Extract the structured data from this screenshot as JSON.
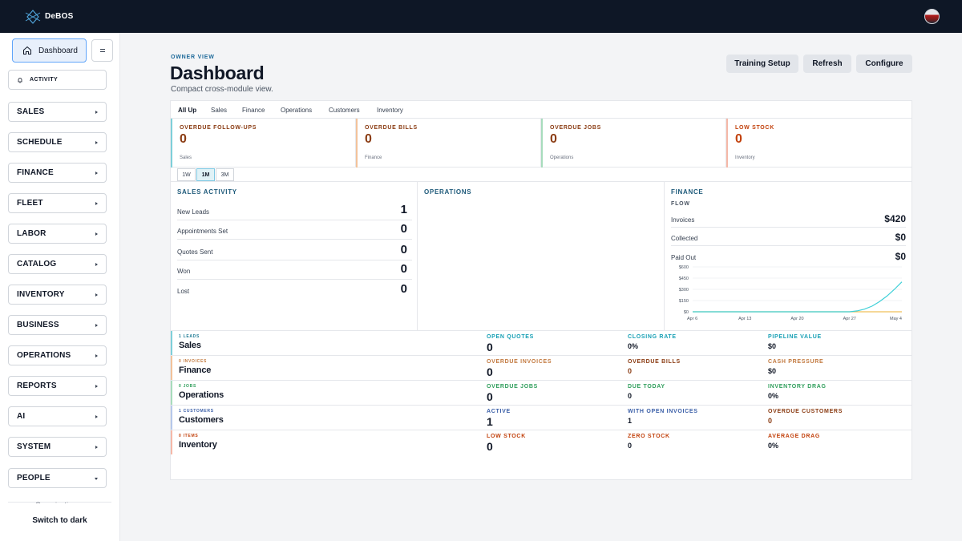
{
  "app": {
    "brand": "DeBOS"
  },
  "sidebar": {
    "dashboard_label": "Dashboard",
    "activity_label": "ACTIVITY",
    "items": [
      {
        "label": "SALES"
      },
      {
        "label": "SCHEDULE"
      },
      {
        "label": "FINANCE"
      },
      {
        "label": "FLEET"
      },
      {
        "label": "LABOR"
      },
      {
        "label": "CATALOG"
      },
      {
        "label": "INVENTORY"
      },
      {
        "label": "BUSINESS"
      },
      {
        "label": "OPERATIONS"
      },
      {
        "label": "REPORTS"
      },
      {
        "label": "AI"
      },
      {
        "label": "SYSTEM"
      },
      {
        "label": "PEOPLE"
      }
    ],
    "footer_peek": "Organization",
    "switch_theme_label": "Switch to dark"
  },
  "header": {
    "eyebrow": "OWNER VIEW",
    "title": "Dashboard",
    "subtitle": "Compact cross-module view.",
    "buttons": {
      "training": "Training Setup",
      "refresh": "Refresh",
      "configure": "Configure"
    }
  },
  "tabs": [
    "All Up",
    "Sales",
    "Finance",
    "Operations",
    "Customers",
    "Inventory"
  ],
  "kpis": [
    {
      "label": "OVERDUE FOLLOW-UPS",
      "value": "0",
      "module": "Sales",
      "color": "#8a3b12",
      "bar": "#7ecfd9"
    },
    {
      "label": "OVERDUE BILLS",
      "value": "0",
      "module": "Finance",
      "color": "#8a3b12",
      "bar": "#f2c29a"
    },
    {
      "label": "OVERDUE JOBS",
      "value": "0",
      "module": "Operations",
      "color": "#8a3b12",
      "bar": "#a7dcbc"
    },
    {
      "label": "LOW STOCK",
      "value": "0",
      "module": "Inventory",
      "color": "#c2410c",
      "bar": "#f5b8a8"
    }
  ],
  "ranges": [
    "1W",
    "1M",
    "3M"
  ],
  "sales_activity": {
    "title": "SALES ACTIVITY",
    "rows": [
      {
        "label": "New Leads",
        "value": "1"
      },
      {
        "label": "Appointments Set",
        "value": "0"
      },
      {
        "label": "Quotes Sent",
        "value": "0"
      },
      {
        "label": "Won",
        "value": "0"
      },
      {
        "label": "Lost",
        "value": "0"
      }
    ]
  },
  "operations": {
    "title": "OPERATIONS"
  },
  "finance": {
    "title": "FINANCE",
    "flow_label": "FLOW",
    "rows": [
      {
        "label": "Invoices",
        "value": "$420"
      },
      {
        "label": "Collected",
        "value": "$0"
      },
      {
        "label": "Paid Out",
        "value": "$0"
      }
    ]
  },
  "chart_data": {
    "type": "line",
    "x_labels": [
      "Apr 6",
      "Apr 13",
      "Apr 20",
      "Apr 27",
      "May 4"
    ],
    "y_labels": [
      "$600",
      "$450",
      "$300",
      "$150",
      "$0"
    ],
    "ylim": [
      0,
      600
    ],
    "series": [
      {
        "values": [
          0,
          0,
          0,
          0,
          0,
          0,
          0,
          0,
          0,
          0,
          0,
          0,
          0,
          0,
          0,
          0,
          0,
          0,
          0,
          0,
          0,
          0,
          0,
          0,
          0,
          0,
          0,
          0,
          0,
          0,
          0,
          0,
          0,
          0,
          0,
          0,
          0,
          0,
          0,
          0,
          0,
          0,
          0,
          0,
          0,
          0,
          0,
          0,
          0,
          0,
          0,
          0,
          0,
          0,
          0,
          0,
          0,
          0,
          0,
          0,
          0,
          0,
          0,
          0,
          0,
          0,
          0,
          0,
          0,
          0,
          0,
          0,
          0,
          0,
          0,
          0,
          0,
          0,
          0,
          0,
          0,
          0,
          0,
          0,
          0,
          0,
          0,
          0,
          0,
          0,
          0,
          0,
          0,
          0,
          0,
          0,
          0,
          0,
          0,
          0,
          0,
          0,
          0,
          0,
          0,
          0,
          0,
          0,
          0,
          0,
          0,
          0,
          0,
          0,
          0,
          0,
          0,
          0,
          0,
          0,
          0,
          0,
          0,
          0,
          0,
          0,
          0,
          0,
          0,
          0,
          0,
          0,
          0,
          0,
          0,
          0,
          0,
          0,
          0,
          0,
          0,
          0,
          0,
          0,
          0,
          0,
          0,
          0,
          0,
          0,
          0,
          0,
          0,
          0,
          0,
          0,
          0,
          0,
          0,
          0,
          0,
          0,
          0,
          0,
          0,
          0,
          0,
          0,
          0,
          0,
          0,
          0,
          0,
          0,
          0,
          0,
          0,
          0,
          0,
          0,
          0,
          0,
          0,
          0,
          0,
          0,
          0,
          0,
          0,
          0,
          0,
          0,
          0,
          0,
          0,
          0,
          0,
          0,
          0,
          0,
          0,
          0,
          0,
          0,
          0,
          0,
          0,
          0,
          0,
          0,
          0,
          0,
          0,
          0,
          0,
          0,
          0,
          0,
          0,
          0,
          0,
          0,
          0,
          0,
          0,
          0,
          0,
          0,
          0,
          0,
          0,
          0,
          0,
          0,
          0,
          0,
          0,
          0,
          0,
          0,
          0,
          0,
          0,
          0,
          0,
          0,
          0,
          0,
          0,
          0
        ],
        "color": "#f0c05a"
      },
      {
        "values": [
          0,
          0,
          0,
          0,
          0,
          0,
          0,
          0,
          0,
          0,
          0,
          0,
          0,
          0,
          0,
          0,
          0,
          0,
          0,
          0,
          0,
          0,
          0,
          0,
          0,
          0,
          0,
          0,
          0,
          0,
          0,
          0,
          0,
          0,
          0,
          0,
          0,
          0,
          0,
          0,
          0,
          0,
          0,
          0,
          0,
          0,
          0,
          0,
          0,
          0,
          0,
          0,
          0,
          0,
          0,
          0,
          0,
          0,
          0,
          0,
          0,
          0,
          0,
          0,
          0,
          0,
          0,
          0,
          0,
          0,
          0,
          0,
          0,
          0,
          0,
          0,
          0,
          0,
          0,
          0,
          0,
          0,
          0,
          0,
          0,
          0,
          0,
          0,
          0,
          0,
          0,
          0,
          0,
          0,
          0,
          0,
          0,
          0,
          0,
          0,
          0,
          0,
          0,
          0,
          0,
          0,
          0,
          0,
          0,
          0,
          0,
          0,
          0,
          0,
          0,
          0,
          0,
          0,
          0,
          0,
          0,
          0,
          0,
          0,
          0,
          0,
          0,
          0,
          0,
          0,
          0,
          0,
          0,
          0,
          0,
          0,
          0,
          0,
          0,
          0,
          0,
          0,
          0,
          0,
          0,
          0,
          0,
          0,
          0,
          0,
          0,
          0,
          0,
          0,
          0,
          0,
          0,
          0,
          0,
          0,
          0,
          0,
          0,
          0,
          0,
          0,
          0,
          0,
          0,
          0,
          0,
          0,
          0,
          0,
          0,
          0,
          0,
          0,
          0,
          0,
          0,
          0,
          0,
          0,
          0,
          0,
          0,
          0,
          0,
          0,
          0,
          0,
          0,
          0,
          0,
          0,
          0,
          0,
          0,
          0,
          0,
          0,
          0,
          0,
          0,
          0,
          0,
          0,
          0,
          0,
          0,
          0,
          0,
          0,
          0,
          0,
          0,
          0,
          0,
          0,
          0,
          0,
          0,
          0,
          0,
          0,
          0,
          0,
          0,
          0,
          0,
          0,
          0,
          0,
          0,
          0,
          0,
          0,
          0,
          0,
          0,
          0,
          0,
          0,
          0,
          0,
          0,
          0,
          0,
          0,
          0,
          0,
          0,
          0,
          0,
          0,
          0,
          0,
          0
        ],
        "color": "#f0c05a"
      }
    ]
  },
  "chart_series": {
    "paid_out": {
      "color": "#f0c05a",
      "points": [
        [
          0,
          0
        ],
        [
          28,
          0
        ]
      ]
    },
    "invoices": {
      "color": "#3fd0d8",
      "points": [
        [
          0,
          0
        ],
        [
          21,
          0
        ],
        [
          22,
          12
        ],
        [
          23,
          35
        ],
        [
          24,
          75
        ],
        [
          25,
          135
        ],
        [
          26,
          210
        ],
        [
          27,
          300
        ],
        [
          28,
          400
        ]
      ]
    }
  },
  "modules": [
    {
      "count": "1 LEADS",
      "name": "Sales",
      "bar": "#7ecfd9",
      "count_color": "#1e7a94",
      "cells": [
        {
          "label": "OPEN QUOTES",
          "value": "0",
          "label_color": "#18a0b5",
          "value_color": "#111827",
          "size": "big"
        },
        {
          "label": "CLOSING RATE",
          "value": "0%",
          "label_color": "#18a0b5",
          "value_color": "#111827",
          "size": "small"
        },
        {
          "label": "PIPELINE VALUE",
          "value": "$0",
          "label_color": "#18a0b5",
          "value_color": "#111827",
          "size": "small"
        }
      ]
    },
    {
      "count": "0 INVOICES",
      "name": "Finance",
      "bar": "#f2c29a",
      "count_color": "#c2793f",
      "cells": [
        {
          "label": "OVERDUE INVOICES",
          "value": "0",
          "label_color": "#c2793f",
          "value_color": "#111827",
          "size": "big"
        },
        {
          "label": "OVERDUE BILLS",
          "value": "0",
          "label_color": "#8a3b12",
          "value_color": "#8a3b12",
          "size": "small"
        },
        {
          "label": "CASH PRESSURE",
          "value": "$0",
          "label_color": "#c2793f",
          "value_color": "#111827",
          "size": "small"
        }
      ]
    },
    {
      "count": "0 JOBS",
      "name": "Operations",
      "bar": "#a7dcbc",
      "count_color": "#2f9e5b",
      "cells": [
        {
          "label": "OVERDUE JOBS",
          "value": "0",
          "label_color": "#2f9e5b",
          "value_color": "#111827",
          "size": "big"
        },
        {
          "label": "DUE TODAY",
          "value": "0",
          "label_color": "#2f9e5b",
          "value_color": "#111827",
          "size": "small"
        },
        {
          "label": "INVENTORY DRAG",
          "value": "0%",
          "label_color": "#2f9e5b",
          "value_color": "#111827",
          "size": "small"
        }
      ]
    },
    {
      "count": "1 CUSTOMERS",
      "name": "Customers",
      "bar": "#b6c8ea",
      "count_color": "#3b5fa8",
      "cells": [
        {
          "label": "ACTIVE",
          "value": "1",
          "label_color": "#3b5fa8",
          "value_color": "#111827",
          "size": "big"
        },
        {
          "label": "WITH OPEN INVOICES",
          "value": "1",
          "label_color": "#3b5fa8",
          "value_color": "#111827",
          "size": "small"
        },
        {
          "label": "OVERDUE CUSTOMERS",
          "value": "0",
          "label_color": "#8a3b12",
          "value_color": "#8a3b12",
          "size": "small"
        }
      ]
    },
    {
      "count": "0 ITEMS",
      "name": "Inventory",
      "bar": "#f5b8a8",
      "count_color": "#c2410c",
      "cells": [
        {
          "label": "LOW STOCK",
          "value": "0",
          "label_color": "#c2410c",
          "value_color": "#111827",
          "size": "big"
        },
        {
          "label": "ZERO STOCK",
          "value": "0",
          "label_color": "#c2410c",
          "value_color": "#111827",
          "size": "small"
        },
        {
          "label": "AVERAGE DRAG",
          "value": "0%",
          "label_color": "#c2410c",
          "value_color": "#111827",
          "size": "small"
        }
      ]
    }
  ]
}
